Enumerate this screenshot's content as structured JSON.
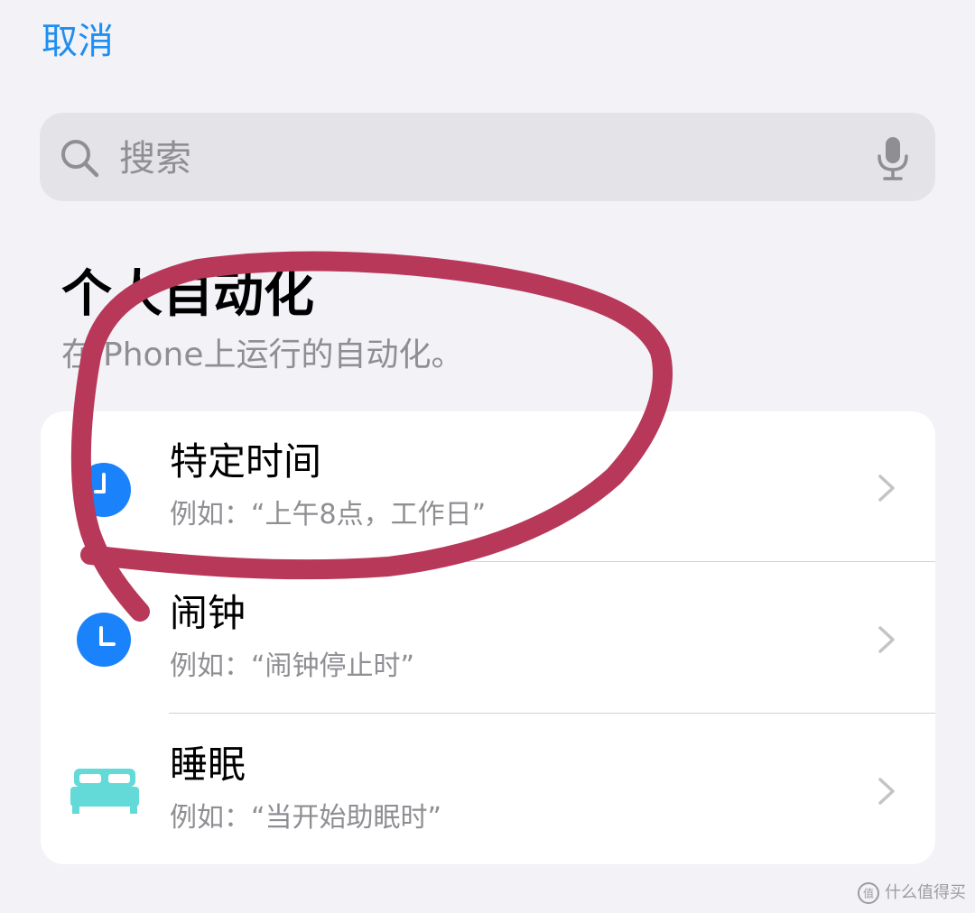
{
  "nav": {
    "cancel_label": "取消"
  },
  "search": {
    "placeholder": "搜索",
    "search_icon": "magnifyingglass-icon",
    "mic_icon": "microphone-icon"
  },
  "section": {
    "title": "个人自动化",
    "subtitle": "在iPhone上运行的自动化。"
  },
  "list": {
    "items": [
      {
        "title": "特定时间",
        "subtitle": "例如：“上午8点，工作日”",
        "icon": "clock-icon",
        "icon_color": "#1a82fb"
      },
      {
        "title": "闹钟",
        "subtitle": "例如：“闹钟停止时”",
        "icon": "alarm-icon",
        "icon_color": "#1a82fb"
      },
      {
        "title": "睡眠",
        "subtitle": "例如：“当开始助眠时”",
        "icon": "bed-icon",
        "icon_color": "#63dad8"
      }
    ]
  },
  "annotation": {
    "stroke_color": "#b8385a"
  },
  "watermark": {
    "text": "什么值得买"
  },
  "colors": {
    "accent": "#1f8ef1",
    "background": "#f2f2f7",
    "card": "#ffffff",
    "secondary_text": "#8e8e93"
  }
}
